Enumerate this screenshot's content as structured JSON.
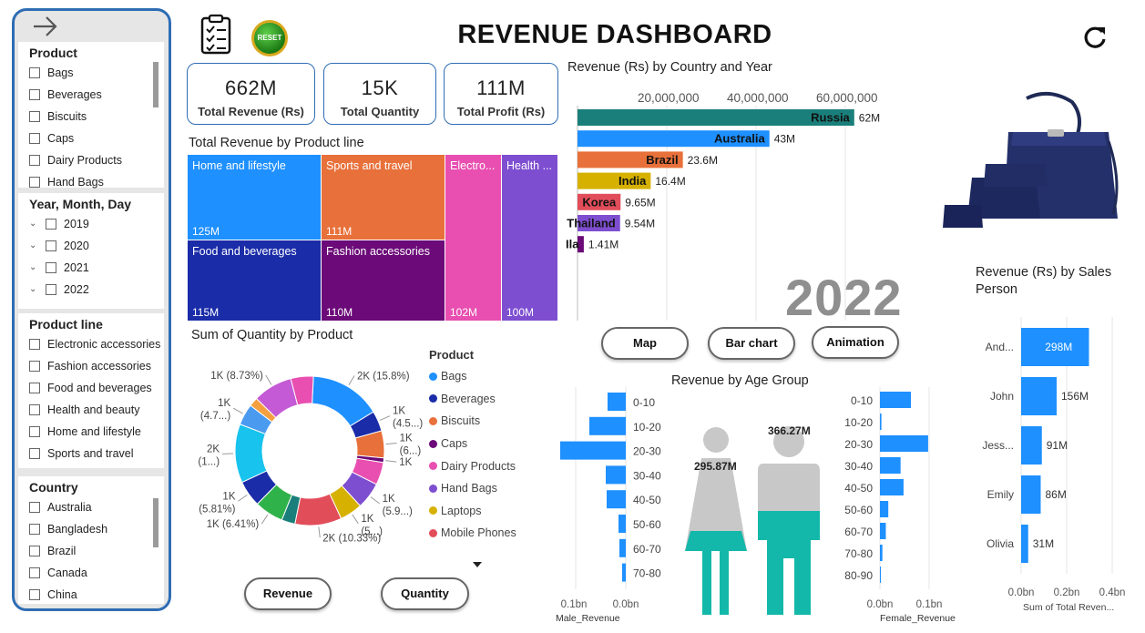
{
  "header": {
    "title": "REVENUE DASHBOARD",
    "reset_label": "RESET"
  },
  "colors": {
    "accent": "#2e6db4",
    "bar_blue": "#1e90ff",
    "teal": "#1a7f7a"
  },
  "slicers": {
    "product": {
      "title": "Product",
      "items": [
        "Bags",
        "Beverages",
        "Biscuits",
        "Caps",
        "Dairy Products",
        "Hand Bags"
      ]
    },
    "date": {
      "title": "Year, Month, Day",
      "items": [
        "2019",
        "2020",
        "2021",
        "2022"
      ]
    },
    "product_line": {
      "title": "Product line",
      "items": [
        "Electronic accessories",
        "Fashion accessories",
        "Food and beverages",
        "Health and beauty",
        "Home and lifestyle",
        "Sports and travel"
      ]
    },
    "country": {
      "title": "Country",
      "items": [
        "Australia",
        "Bangladesh",
        "Brazil",
        "Canada",
        "China"
      ]
    }
  },
  "kpis": [
    {
      "value": "662M",
      "label": "Total Revenue (Rs)"
    },
    {
      "value": "15K",
      "label": "Total Quantity"
    },
    {
      "value": "111M",
      "label": "Total Profit (Rs)"
    }
  ],
  "treemap": {
    "title": "Total Revenue by Product line",
    "cells": [
      {
        "name": "Home and lifestyle",
        "value": "125M",
        "color": "#1e90ff"
      },
      {
        "name": "Sports and travel",
        "value": "111M",
        "color": "#e8703a"
      },
      {
        "name": "Electro...",
        "value": "102M",
        "color": "#e84fb0"
      },
      {
        "name": "Health ...",
        "value": "100M",
        "color": "#7e4ed0"
      },
      {
        "name": "Food and beverages",
        "value": "115M",
        "color": "#1a2ca8"
      },
      {
        "name": "Fashion accessories",
        "value": "110M",
        "color": "#6b0a78"
      }
    ]
  },
  "buttons": {
    "map": "Map",
    "bar_chart": "Bar chart",
    "animation": "Animation",
    "revenue": "Revenue",
    "quantity": "Quantity"
  },
  "country_chart": {
    "title": "Revenue (Rs) by Country and Year",
    "year": "2022",
    "ticks": [
      "20,000,000",
      "40,000,000",
      "60,000,000"
    ]
  },
  "sales_person_chart": {
    "title_line1": "Revenue (Rs) by Sales",
    "title_line2": "Person",
    "xlabel": "Sum of Total Reven...",
    "ticks": [
      "0.0bn",
      "0.2bn",
      "0.4bn"
    ]
  },
  "donut": {
    "title": "Sum of Quantity by Product",
    "legend_title": "Product"
  },
  "age_chart": {
    "title": "Revenue by Age Group",
    "male_total": "295.87M",
    "female_total": "366.27M",
    "male_axis": "Male_Revenue",
    "female_axis": "Female_Revenue",
    "male_ticks": [
      "0.1bn",
      "0.0bn"
    ],
    "female_ticks": [
      "0.0bn",
      "0.1bn"
    ]
  },
  "chart_data": [
    {
      "type": "bar",
      "title": "Revenue (Rs) by Country and Year",
      "categories": [
        "Russia",
        "Australia",
        "Brazil",
        "India",
        "Korea",
        "Thailand",
        "Ila"
      ],
      "values": [
        62000000,
        43000000,
        23600000,
        16400000,
        9650000,
        9540000,
        1410000
      ],
      "labels": [
        "62M",
        "43M",
        "23.6M",
        "16.4M",
        "9.65M",
        "9.54M",
        "1.41M"
      ],
      "colors": [
        "#1a7f7a",
        "#1e90ff",
        "#e8703a",
        "#d6b100",
        "#e24d5a",
        "#7e4ed0",
        "#6b0a78"
      ],
      "xlim": [
        0,
        65000000
      ]
    },
    {
      "type": "bar",
      "title": "Revenue (Rs) by Sales Person",
      "categories": [
        "And...",
        "John",
        "Jess...",
        "Emily",
        "Olivia"
      ],
      "values": [
        298,
        156,
        91,
        86,
        31
      ],
      "labels": [
        "298M",
        "156M",
        "91M",
        "86M",
        "31M"
      ],
      "xlim": [
        0,
        400
      ]
    },
    {
      "type": "pie",
      "title": "Sum of Quantity by Product",
      "series": [
        {
          "name": "Bags",
          "value": 15.8,
          "label": "2K (15.8%)",
          "color": "#1e90ff"
        },
        {
          "name": "Beverages",
          "value": 4.5,
          "label": "1K (4.5...)",
          "color": "#1a2ca8"
        },
        {
          "name": "Biscuits",
          "value": 6.0,
          "label": "1K (6...)",
          "color": "#e8703a"
        },
        {
          "name": "Caps",
          "value": 1.0,
          "label": "1K",
          "color": "#6b0a78"
        },
        {
          "name": "Dairy Products",
          "value": 5.0,
          "label": "",
          "color": "#e84fb0"
        },
        {
          "name": "Hand Bags",
          "value": 5.9,
          "label": "1K (5.9...)",
          "color": "#7e4ed0"
        },
        {
          "name": "Laptops",
          "value": 5.0,
          "label": "1K (5...)",
          "color": "#d6b100"
        },
        {
          "name": "Mobile Phones",
          "value": 10.33,
          "label": "2K (10.33%)",
          "color": "#e24d5a"
        },
        {
          "name": "",
          "value": 3.0,
          "label": "",
          "color": "#1a7f7a"
        },
        {
          "name": "",
          "value": 6.41,
          "label": "1K (6.41%)",
          "color": "#2fb24a"
        },
        {
          "name": "",
          "value": 5.81,
          "label": "1K (5.81%)",
          "color": "#1a2ca8"
        },
        {
          "name": "",
          "value": 13.0,
          "label": "2K (1...)",
          "color": "#18c3ee"
        },
        {
          "name": "",
          "value": 4.7,
          "label": "1K (4.7...)",
          "color": "#4a9af0"
        },
        {
          "name": "",
          "value": 2.0,
          "label": "",
          "color": "#f4a040"
        },
        {
          "name": "",
          "value": 8.73,
          "label": "1K (8.73%)",
          "color": "#c45ad6"
        },
        {
          "name": "",
          "value": 5.0,
          "label": "",
          "color": "#e84fb0"
        }
      ]
    },
    {
      "type": "bar",
      "title": "Revenue by Age Group",
      "categories": [
        "0-10",
        "10-20",
        "20-30",
        "30-40",
        "40-50",
        "50-60",
        "60-70",
        "70-80",
        "80-90"
      ],
      "male_values": [
        0.02,
        0.04,
        0.072,
        0.022,
        0.021,
        0.008,
        0.007,
        0.004,
        0
      ],
      "female_values": [
        0.063,
        0.003,
        0.098,
        0.042,
        0.048,
        0.017,
        0.012,
        0.005,
        0.002
      ],
      "xlabel_left": "Male_Revenue",
      "xlabel_right": "Female_Revenue"
    }
  ]
}
